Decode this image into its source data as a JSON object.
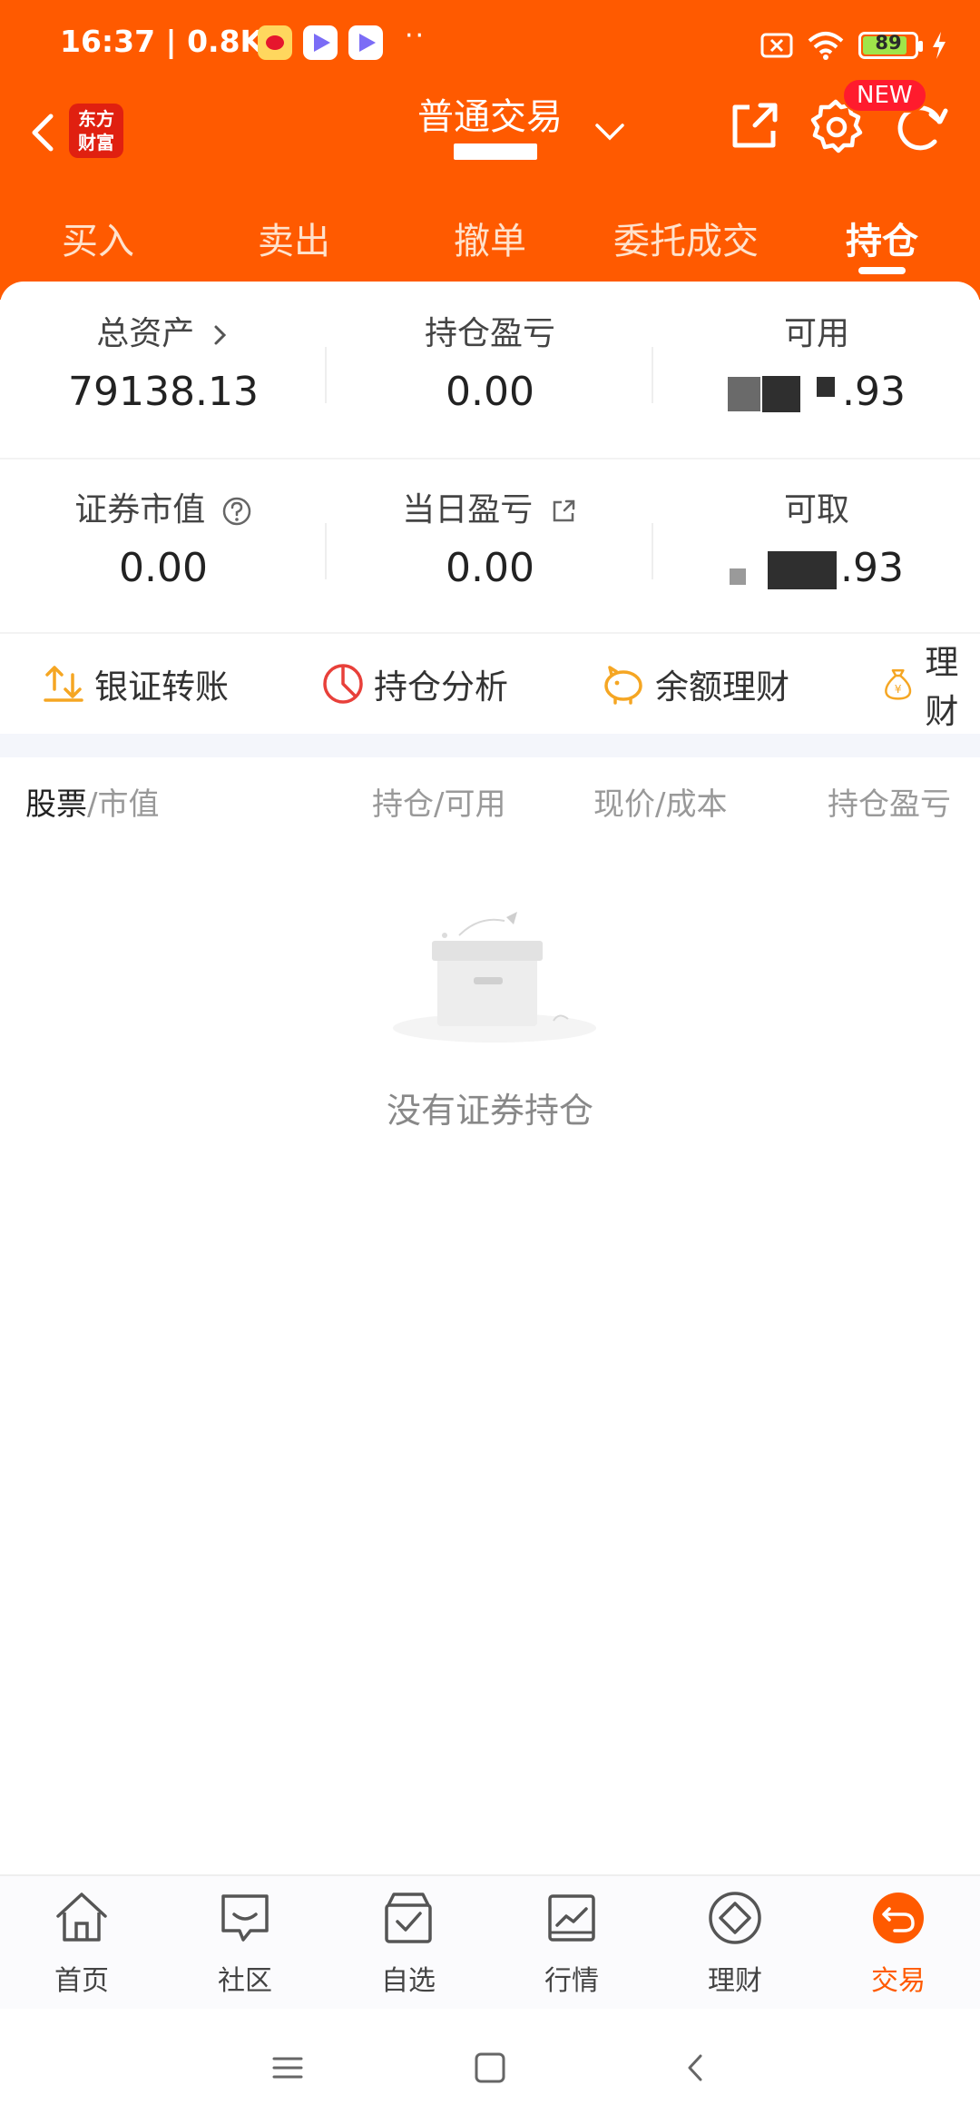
{
  "status_bar": {
    "time_speed": "16:37 | 0.8K/s",
    "more_dots": "··",
    "battery_percent": "89"
  },
  "header": {
    "brand_logo_line1": "东方",
    "brand_logo_line2": "财富",
    "title": "普通交易",
    "new_badge": "NEW",
    "accent_color": "#ff5a00"
  },
  "tabs": [
    {
      "label": "买入"
    },
    {
      "label": "卖出"
    },
    {
      "label": "撤单"
    },
    {
      "label": "委托成交"
    },
    {
      "label": "持仓"
    }
  ],
  "summary": {
    "total_assets": {
      "label": "总资产",
      "value": "79138.13"
    },
    "position_pnl": {
      "label": "持仓盈亏",
      "value": "0.00"
    },
    "available": {
      "label": "可用",
      "value_suffix": ".93"
    },
    "securities_value": {
      "label": "证券市值",
      "value": "0.00"
    },
    "daily_pnl": {
      "label": "当日盈亏",
      "value": "0.00"
    },
    "withdrawable": {
      "label": "可取",
      "value_suffix": ".93"
    }
  },
  "quick_actions": [
    {
      "label": "银证转账",
      "icon": "transfer-icon"
    },
    {
      "label": "持仓分析",
      "icon": "pie-chart-icon"
    },
    {
      "label": "余额理财",
      "icon": "piggy-bank-icon"
    },
    {
      "label": "理财",
      "icon": "money-bag-icon"
    }
  ],
  "table_header": {
    "col1_strong": "股票",
    "col1_rest": "/市值",
    "col2": "持仓/可用",
    "col3": "现价/成本",
    "col4": "持仓盈亏"
  },
  "empty_state": {
    "message": "没有证券持仓"
  },
  "bottom_nav": [
    {
      "label": "首页",
      "icon": "home-icon"
    },
    {
      "label": "社区",
      "icon": "community-icon"
    },
    {
      "label": "自选",
      "icon": "watchlist-icon"
    },
    {
      "label": "行情",
      "icon": "market-icon"
    },
    {
      "label": "理财",
      "icon": "wealth-icon"
    },
    {
      "label": "交易",
      "icon": "trade-icon"
    }
  ]
}
